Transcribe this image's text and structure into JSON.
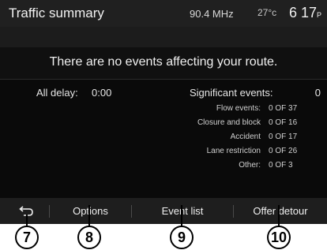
{
  "header": {
    "title": "Traffic summary",
    "frequency": "90.4 MHz",
    "temperature": "27°c",
    "time": "6 17",
    "time_suffix": "P"
  },
  "message": "There are no events affecting your route.",
  "stats": {
    "delay_label": "All delay:",
    "delay_value": "0:00",
    "significant_label": "Significant events:",
    "significant_value": "0",
    "events": [
      {
        "label": "Flow events:",
        "value": "0 OF 37"
      },
      {
        "label": "Closure and block",
        "value": "0 OF 16"
      },
      {
        "label": "Accident",
        "value": "0 OF 17"
      },
      {
        "label": "Lane restriction",
        "value": "0 OF 26"
      },
      {
        "label": "Other:",
        "value": "0 OF 3"
      }
    ]
  },
  "softkeys": {
    "back_icon": "back-arrow-icon",
    "options": "Options",
    "event_list": "Event list",
    "offer_detour": "Offer detour"
  },
  "callouts": [
    "7",
    "8",
    "9",
    "10"
  ]
}
